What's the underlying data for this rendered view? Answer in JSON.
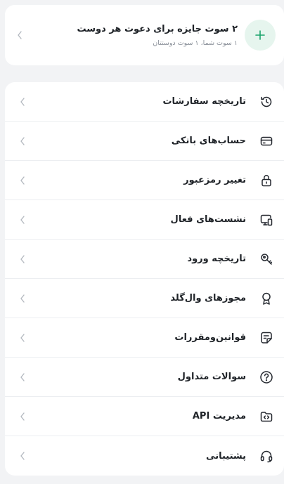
{
  "invite": {
    "title": "۲ سوت جایزه برای دعوت هر دوست",
    "subtitle": "۱ سوت شما، ۱ سوت دوستتان",
    "icon": "plus-icon",
    "accent": "#1aa36b"
  },
  "menu": [
    {
      "label": "تاریخچه سفارشات",
      "icon": "history-icon"
    },
    {
      "label": "حساب‌های بانکی",
      "icon": "credit-card-icon"
    },
    {
      "label": "تغییر رمزعبور",
      "icon": "lock-icon"
    },
    {
      "label": "نشست‌های فعال",
      "icon": "devices-icon"
    },
    {
      "label": "تاریخچه ورود",
      "icon": "key-icon"
    },
    {
      "label": "مجوزهای وال‌گلد",
      "icon": "award-icon"
    },
    {
      "label": "قوانین‌ومقررات",
      "icon": "document-icon"
    },
    {
      "label": "سوالات متداول",
      "icon": "help-icon"
    },
    {
      "label": "مدیریت API",
      "icon": "api-folder-icon"
    },
    {
      "label": "پشتیبانی",
      "icon": "headset-icon"
    }
  ]
}
